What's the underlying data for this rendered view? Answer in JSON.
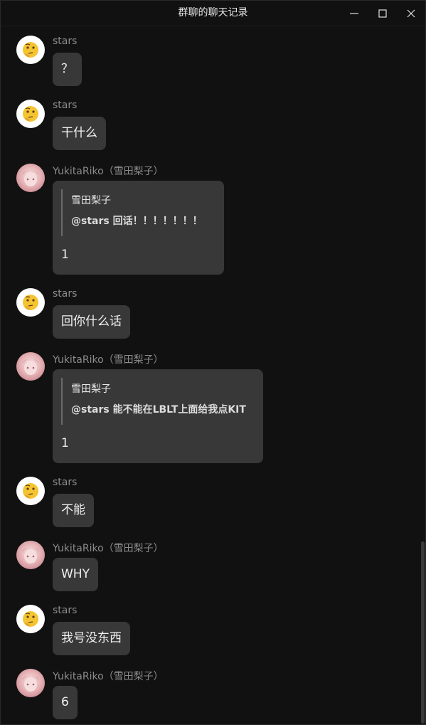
{
  "window": {
    "title": "群聊的聊天记录"
  },
  "icons": {
    "minimize": "minimize-icon",
    "maximize": "maximize-icon",
    "close": "close-icon",
    "stars_avatar": "thinking-face-emoji",
    "riko_avatar": "anime-girl-avatar"
  },
  "colors": {
    "background": "#111111",
    "bubble": "#383838",
    "sender_name": "#8c8c8c"
  },
  "messages": [
    {
      "sender": "stars",
      "text": "？"
    },
    {
      "sender": "stars",
      "text": "干什么"
    },
    {
      "sender": "YukitaRiko（雪田梨子）",
      "quote": {
        "author": "雪田梨子",
        "text": "@stars 回话！！！！！！！"
      },
      "text": "1"
    },
    {
      "sender": "stars",
      "text": "回你什么话"
    },
    {
      "sender": "YukitaRiko（雪田梨子）",
      "quote": {
        "author": "雪田梨子",
        "text": "@stars 能不能在LBLT上面给我点KIT"
      },
      "text": "1"
    },
    {
      "sender": "stars",
      "text": "不能"
    },
    {
      "sender": "YukitaRiko（雪田梨子）",
      "text": "WHY"
    },
    {
      "sender": "stars",
      "text": "我号没东西"
    },
    {
      "sender": "YukitaRiko（雪田梨子）",
      "text": "6"
    }
  ]
}
